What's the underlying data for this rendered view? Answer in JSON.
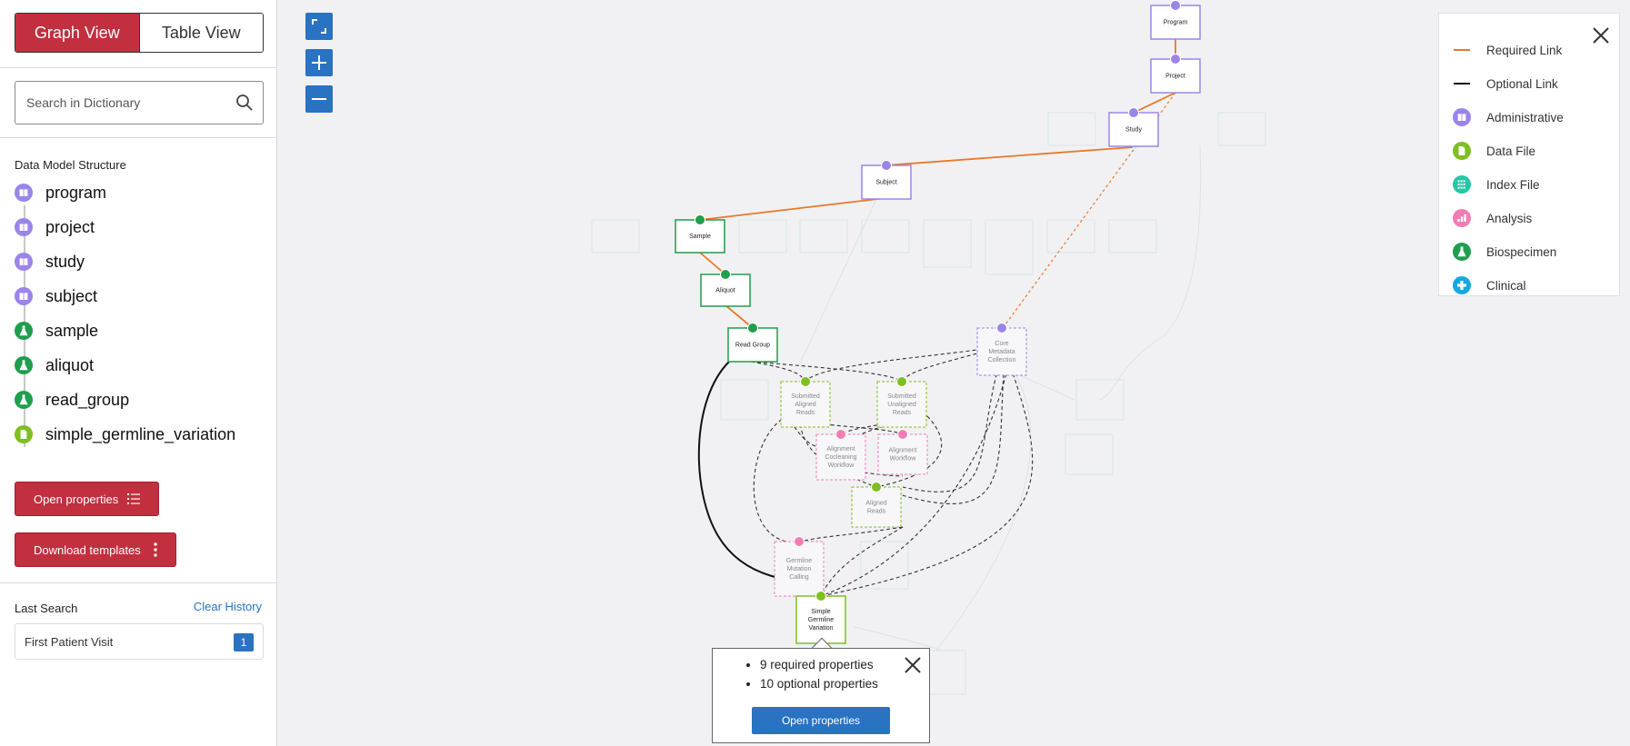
{
  "sidebar": {
    "tabs": [
      {
        "label": "Graph View",
        "active": true
      },
      {
        "label": "Table View",
        "active": false
      }
    ],
    "search": {
      "placeholder": "Search in Dictionary"
    },
    "structure_title": "Data Model Structure",
    "structure_items": [
      {
        "label": "program",
        "category": "administrative"
      },
      {
        "label": "project",
        "category": "administrative"
      },
      {
        "label": "study",
        "category": "administrative"
      },
      {
        "label": "subject",
        "category": "administrative"
      },
      {
        "label": "sample",
        "category": "biospecimen"
      },
      {
        "label": "aliquot",
        "category": "biospecimen"
      },
      {
        "label": "read_group",
        "category": "biospecimen"
      },
      {
        "label": "simple_germline_variation",
        "category": "data_file"
      }
    ],
    "open_properties_label": "Open properties",
    "download_templates_label": "Download templates",
    "last_search_label": "Last Search",
    "clear_history_label": "Clear History",
    "history": [
      {
        "text": "First Patient Visit",
        "count": "1"
      }
    ]
  },
  "legend": {
    "items": [
      {
        "label": "Required Link",
        "kind": "line",
        "color": "#e8782a"
      },
      {
        "label": "Optional Link",
        "kind": "line",
        "color": "#111111"
      },
      {
        "label": "Administrative",
        "kind": "icon",
        "color": "#9b85ea",
        "icon": "book-icon"
      },
      {
        "label": "Data File",
        "kind": "icon",
        "color": "#7ebf22",
        "icon": "file-icon"
      },
      {
        "label": "Index File",
        "kind": "icon",
        "color": "#26c6a8",
        "icon": "grid-icon"
      },
      {
        "label": "Analysis",
        "kind": "icon",
        "color": "#f27db5",
        "icon": "bar-chart-icon"
      },
      {
        "label": "Biospecimen",
        "kind": "icon",
        "color": "#1f9e4e",
        "icon": "flask-icon"
      },
      {
        "label": "Clinical",
        "kind": "icon",
        "color": "#17a7e0",
        "icon": "plus-icon"
      }
    ]
  },
  "graph": {
    "nodes": [
      {
        "id": "program",
        "lines": [
          "Program"
        ]
      },
      {
        "id": "project",
        "lines": [
          "Project"
        ]
      },
      {
        "id": "study",
        "lines": [
          "Study"
        ]
      },
      {
        "id": "subject",
        "lines": [
          "Subject"
        ]
      },
      {
        "id": "sample",
        "lines": [
          "Sample"
        ]
      },
      {
        "id": "aliquot",
        "lines": [
          "Aliquot"
        ]
      },
      {
        "id": "read_group",
        "lines": [
          "Read Group"
        ]
      },
      {
        "id": "core_metadata",
        "lines": [
          "Core",
          "Metadata",
          "Collection"
        ]
      },
      {
        "id": "submitted_aligned",
        "lines": [
          "Submitted",
          "Aligned",
          "Reads"
        ]
      },
      {
        "id": "submitted_unaligned",
        "lines": [
          "Submitted",
          "Unaligned",
          "Reads"
        ]
      },
      {
        "id": "alignment_cocleaning",
        "lines": [
          "Alignment",
          "Cocleaning",
          "Workflow"
        ]
      },
      {
        "id": "alignment_workflow",
        "lines": [
          "Alignment",
          "Workflow"
        ]
      },
      {
        "id": "aligned_reads",
        "lines": [
          "Aligned",
          "Reads"
        ]
      },
      {
        "id": "germline_calling",
        "lines": [
          "Germline",
          "Mutation",
          "Calling"
        ]
      },
      {
        "id": "simple_germline",
        "lines": [
          "Simple",
          "Germline",
          "Variation"
        ]
      }
    ]
  },
  "popup": {
    "bullets": [
      "9 required properties",
      "10 optional properties"
    ],
    "button_label": "Open properties"
  }
}
